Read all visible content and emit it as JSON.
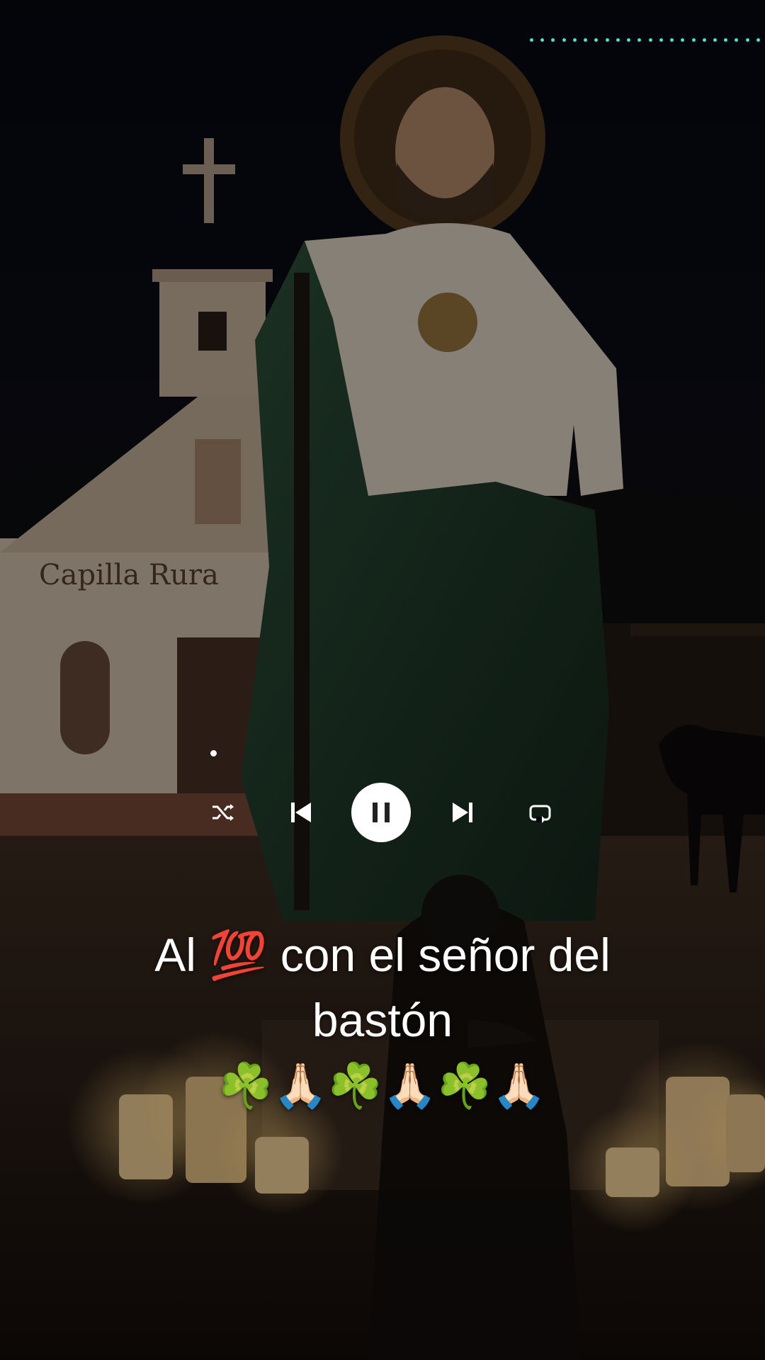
{
  "caption": {
    "line1": "Al 💯 con el señor del",
    "line2": "bastón",
    "line3": "☘️🙏🏻☘️🙏🏻☘️🙏🏻"
  },
  "background": {
    "church_sign": "Capilla Rura"
  },
  "player": {
    "state": "playing"
  },
  "icons": {
    "shuffle": "shuffle-icon",
    "previous": "skip-previous-icon",
    "pause": "pause-icon",
    "next": "skip-next-icon",
    "repeat": "repeat-icon"
  },
  "colors": {
    "accent_dots": "#4fe0c8",
    "caption_text": "#ffffff",
    "control_icons": "#ffffff",
    "robe_green": "#1f3a2a"
  }
}
